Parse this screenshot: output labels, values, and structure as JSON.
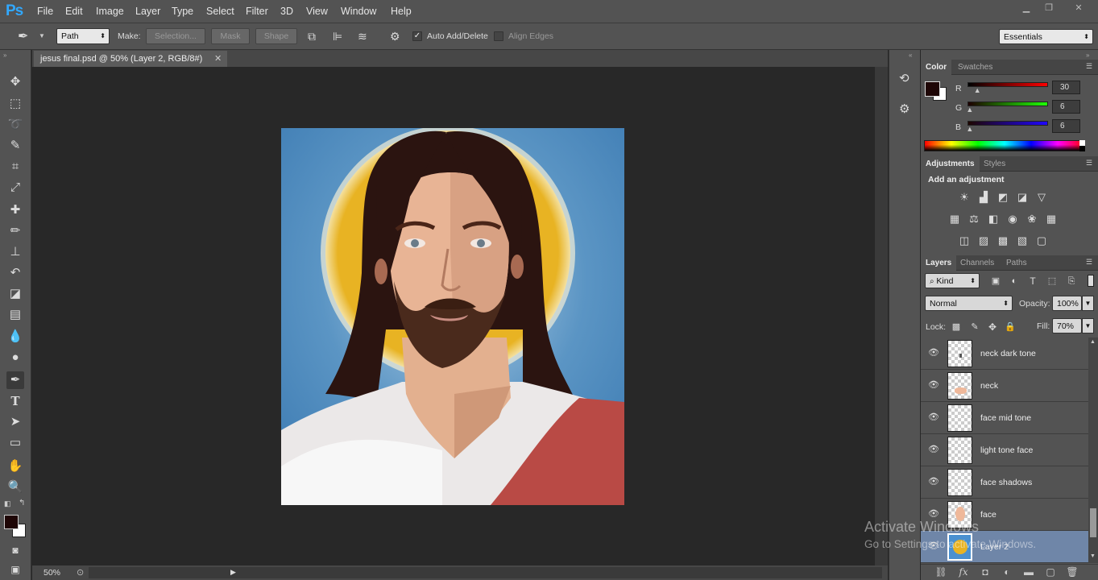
{
  "app": {
    "logo": "Ps"
  },
  "menu": [
    "File",
    "Edit",
    "Image",
    "Layer",
    "Type",
    "Select",
    "Filter",
    "3D",
    "View",
    "Window",
    "Help"
  ],
  "window_controls": {
    "minimize": "▁",
    "restore": "❐",
    "close": "✕"
  },
  "options": {
    "tool_mode": "Path",
    "make_label": "Make:",
    "selection_btn": "Selection...",
    "mask_btn": "Mask",
    "shape_btn": "Shape",
    "auto_add_delete": "Auto Add/Delete",
    "auto_add_delete_checked": true,
    "align_edges": "Align Edges",
    "align_edges_checked": false,
    "workspace": "Essentials"
  },
  "document": {
    "tab_title": "jesus final.psd @ 50% (Layer 2, RGB/8#)",
    "zoom": "50%"
  },
  "color_panel": {
    "tabs": [
      "Color",
      "Swatches"
    ],
    "r_label": "R",
    "g_label": "G",
    "b_label": "B",
    "r_value": "30",
    "g_value": "6",
    "b_value": "6",
    "r_fraction": 0.118,
    "g_fraction": 0.024,
    "b_fraction": 0.024,
    "foreground": "#1e0606",
    "background": "#ffffff"
  },
  "adjustments_panel": {
    "tabs": [
      "Adjustments",
      "Styles"
    ],
    "title": "Add an adjustment",
    "icons": [
      "brightness-contrast-icon",
      "levels-icon",
      "curves-icon",
      "exposure-icon",
      "vibrance-icon",
      "hue-saturation-icon",
      "color-balance-icon",
      "black-white-icon",
      "photo-filter-icon",
      "channel-mixer-icon",
      "color-lookup-icon",
      "invert-icon",
      "posterize-icon",
      "threshold-icon",
      "gradient-map-icon",
      "selective-color-icon"
    ]
  },
  "layers_panel": {
    "tabs": [
      "Layers",
      "Channels",
      "Paths"
    ],
    "filter_kind": "Kind",
    "blend_mode": "Normal",
    "opacity_label": "Opacity:",
    "opacity": "100%",
    "lock_label": "Lock:",
    "fill_label": "Fill:",
    "fill": "70%",
    "layers": [
      {
        "name": "neck dark tone",
        "thumb": "dark-dot"
      },
      {
        "name": "neck",
        "thumb": "skin-blob"
      },
      {
        "name": "face mid tone",
        "thumb": "empty"
      },
      {
        "name": "light tone face",
        "thumb": "empty"
      },
      {
        "name": "face shadows",
        "thumb": "empty"
      },
      {
        "name": "face",
        "thumb": "face-shape"
      },
      {
        "name": "Layer 2",
        "thumb": "halo",
        "selected": true
      }
    ]
  },
  "watermark": {
    "line1": "Activate Windows",
    "line2": "Go to Settings to activate Windows."
  },
  "colors": {
    "accent": "#31a8ff",
    "selected_layer": "#6f86a8",
    "halo": "#e8b323",
    "sky": "#5b95c4",
    "robe": "#b94a45"
  }
}
